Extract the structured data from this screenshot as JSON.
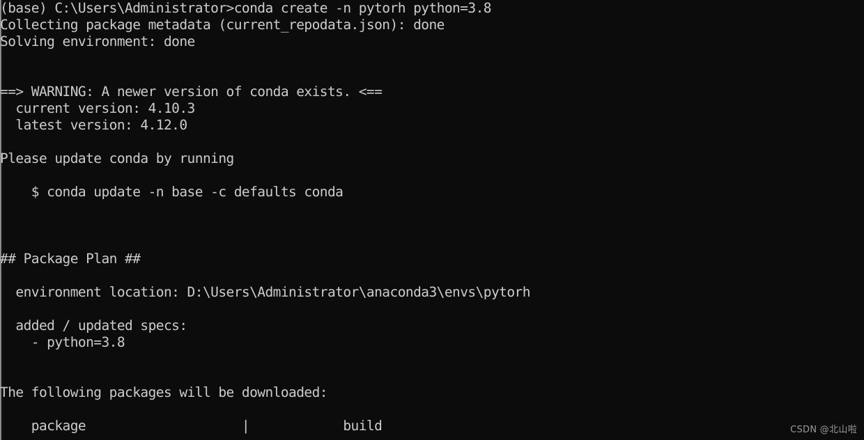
{
  "terminal": {
    "background_color": "#0c0c0c",
    "foreground_color": "#cccccc",
    "prompt": "(base) C:\\Users\\Administrator>",
    "command": "conda create -n pytorh python=3.8",
    "lines": [
      "(base) C:\\Users\\Administrator>conda create -n pytorh python=3.8",
      "Collecting package metadata (current_repodata.json): done",
      "Solving environment: done",
      "",
      "",
      "==> WARNING: A newer version of conda exists. <==",
      "  current version: 4.10.3",
      "  latest version: 4.12.0",
      "",
      "Please update conda by running",
      "",
      "    $ conda update -n base -c defaults conda",
      "",
      "",
      "",
      "## Package Plan ##",
      "",
      "  environment location: D:\\Users\\Administrator\\anaconda3\\envs\\pytorh",
      "",
      "  added / updated specs:",
      "    - python=3.8",
      "",
      "",
      "The following packages will be downloaded:",
      "",
      "    package                    |            build"
    ]
  },
  "details": {
    "env_name": "pytorh",
    "python_spec": "python=3.8",
    "current_version": "4.10.3",
    "latest_version": "4.12.0",
    "environment_location": "D:\\Users\\Administrator\\anaconda3\\envs\\pytorh",
    "update_command": "$ conda update -n base -c defaults conda",
    "package_plan_heading": "## Package Plan ##",
    "table_headers": {
      "package": "package",
      "build": "build"
    }
  },
  "watermark": {
    "text": "CSDN @北山啦"
  }
}
